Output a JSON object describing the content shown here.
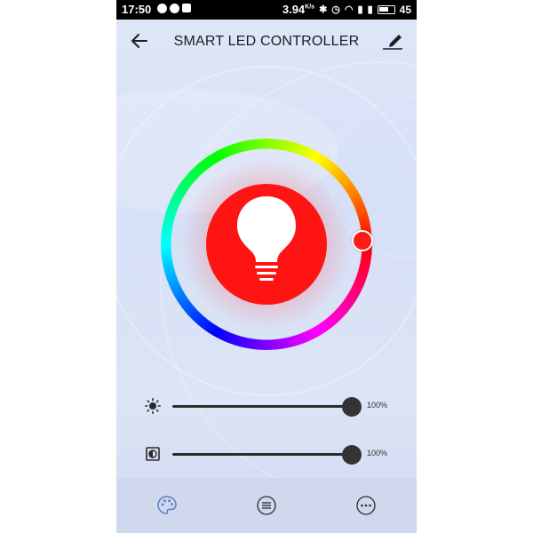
{
  "status_bar": {
    "time": "17:50",
    "net_speed": "3.94",
    "net_unit": "K/s",
    "battery": "45"
  },
  "app_bar": {
    "title": "SMART LED CONTROLLER",
    "back_icon": "arrow-left-icon",
    "edit_icon": "pencil-icon"
  },
  "color_picker": {
    "selected_color": "#ff1414",
    "ring_icon": "color-wheel",
    "bulb_icon": "lightbulb-icon"
  },
  "sliders": [
    {
      "icon": "brightness-icon",
      "value": 100,
      "label": "100%"
    },
    {
      "icon": "contrast-icon",
      "value": 100,
      "label": "100%"
    }
  ],
  "bottom_nav": [
    {
      "icon": "palette-icon",
      "active": true
    },
    {
      "icon": "list-icon",
      "active": false
    },
    {
      "icon": "more-icon",
      "active": false
    }
  ],
  "colors": {
    "accent": "#5a7fc0",
    "background": "#dbe3f6",
    "bulb_disk": "#ff1414"
  }
}
